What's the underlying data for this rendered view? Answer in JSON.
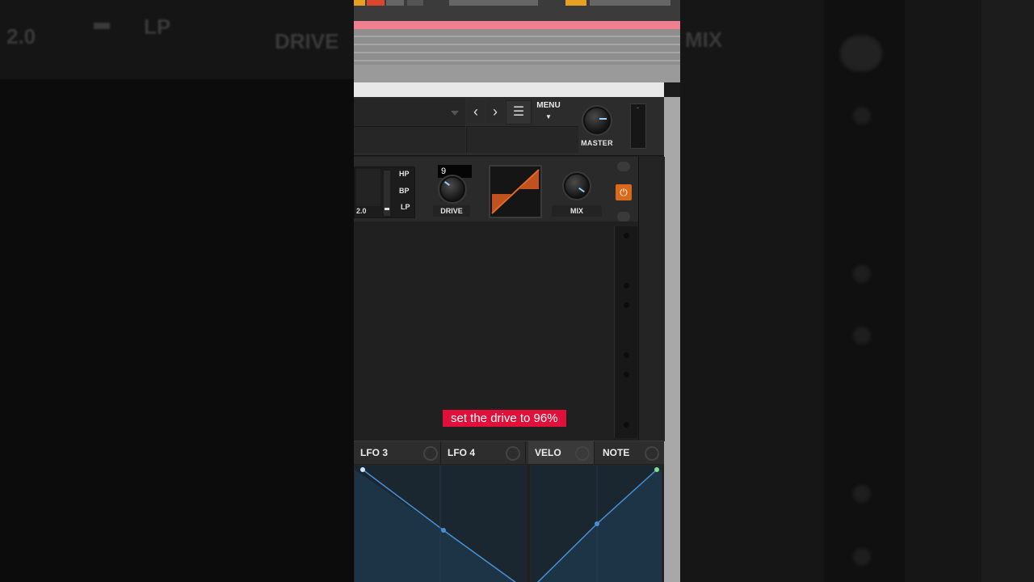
{
  "background": {
    "left_value": "2.0",
    "left_type": "LP",
    "left_knob_label": "DRIVE",
    "right_knob_label": "MIX"
  },
  "header": {
    "menu_label": "MENU",
    "master_label": "MASTER",
    "prev_icon": "chevron-left-icon",
    "next_icon": "chevron-right-icon"
  },
  "effect": {
    "value_left": "2.0",
    "filter_types": [
      "HP",
      "BP",
      "LP"
    ],
    "drive_input": "9",
    "drive_label": "DRIVE",
    "mix_label": "MIX",
    "power_on": true,
    "accent_color": "#d96a1c"
  },
  "caption": "set the drive to 96%",
  "modulators": {
    "tabs": [
      "LFO 3",
      "LFO 4",
      "VELO",
      "NOTE"
    ],
    "active": "VELO",
    "curve_color": "#4a8fd6"
  }
}
